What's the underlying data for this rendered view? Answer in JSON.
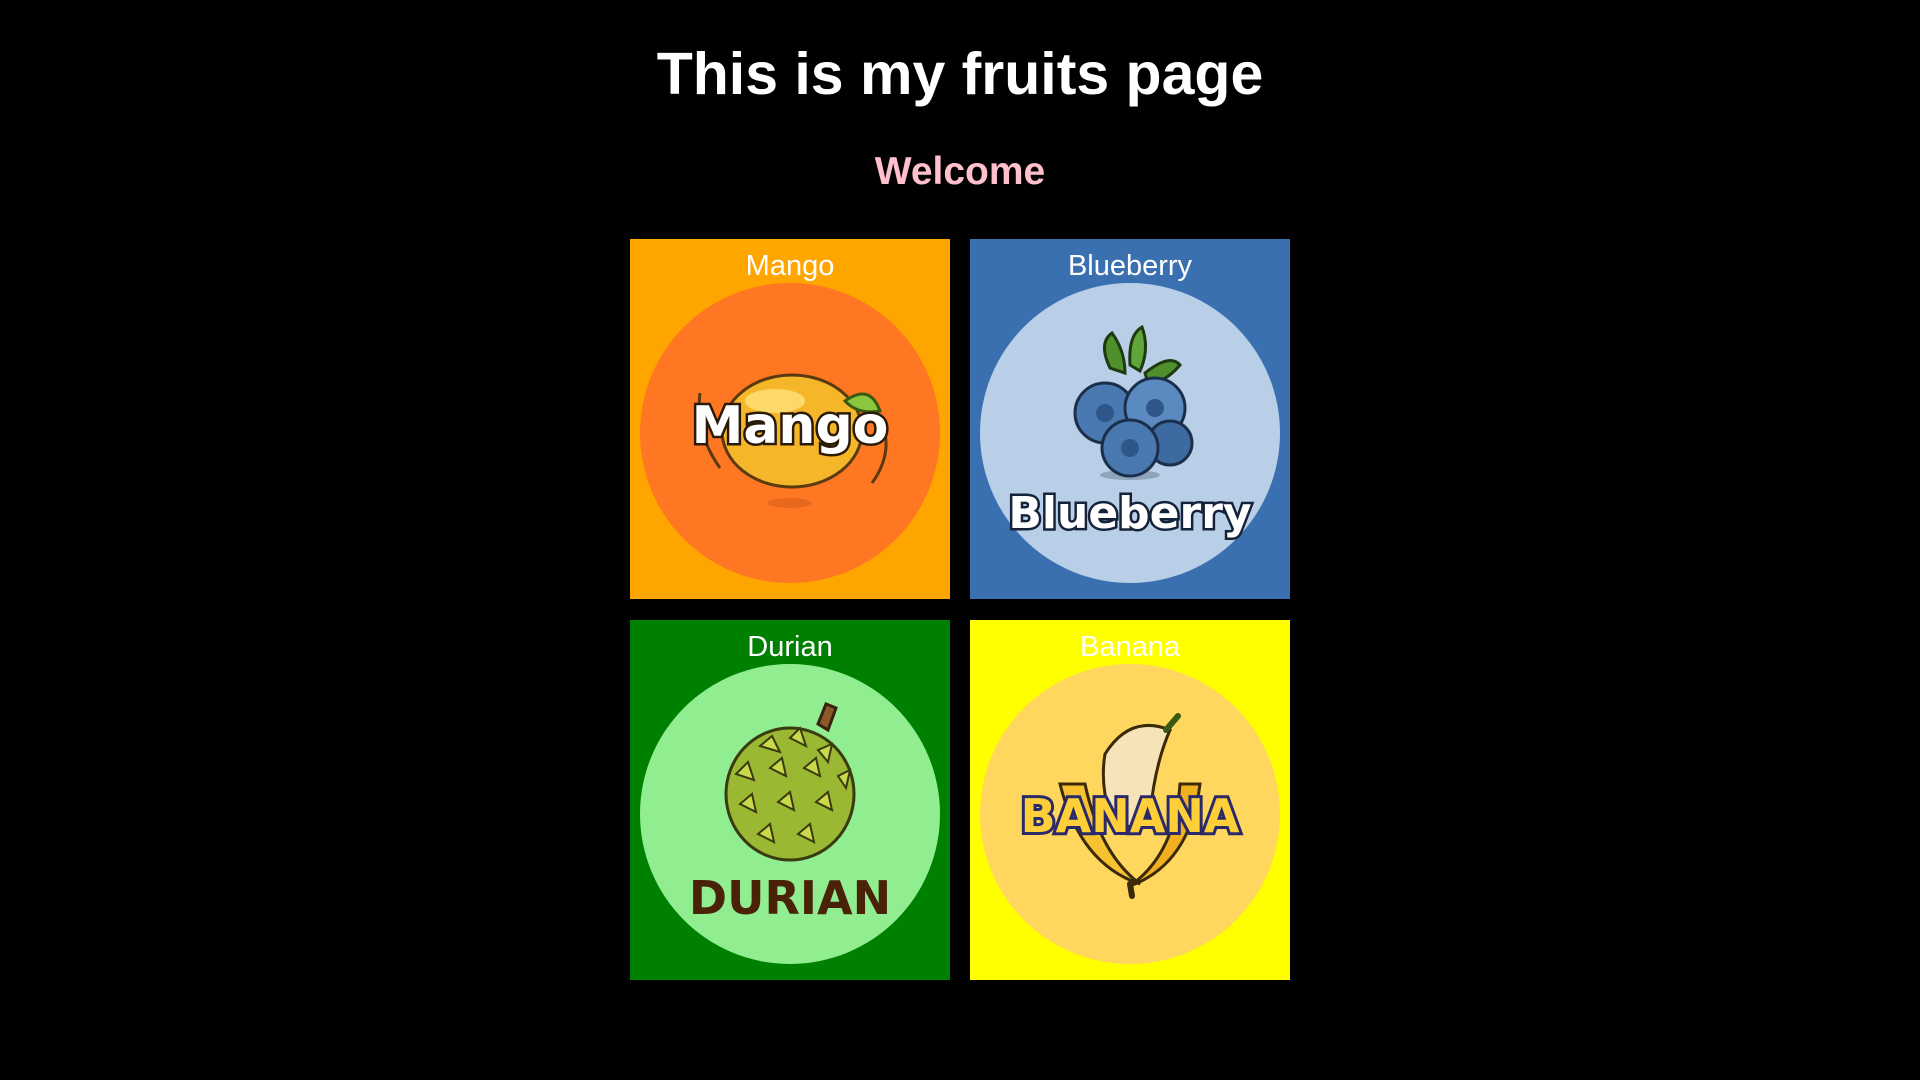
{
  "page": {
    "title": "This is my fruits page",
    "subtitle": "Welcome",
    "background": "#000000",
    "subtitle_color": "#ffc0cb"
  },
  "fruits": [
    {
      "label": "Mango",
      "logo_text": "Mango",
      "icon": "mango-logo",
      "card_color": "#ffa500",
      "circle_color": "#ff7722"
    },
    {
      "label": "Blueberry",
      "logo_text": "Blueberry",
      "icon": "blueberry-logo",
      "card_color": "#3a70b0",
      "circle_color": "#b9cfe8"
    },
    {
      "label": "Durian",
      "logo_text": "DURIAN",
      "icon": "durian-logo",
      "card_color": "#008000",
      "circle_color": "#90ee90"
    },
    {
      "label": "Banana",
      "logo_text": "BANANA",
      "icon": "banana-logo",
      "card_color": "#ffff00",
      "circle_color": "#ffd75e"
    }
  ]
}
